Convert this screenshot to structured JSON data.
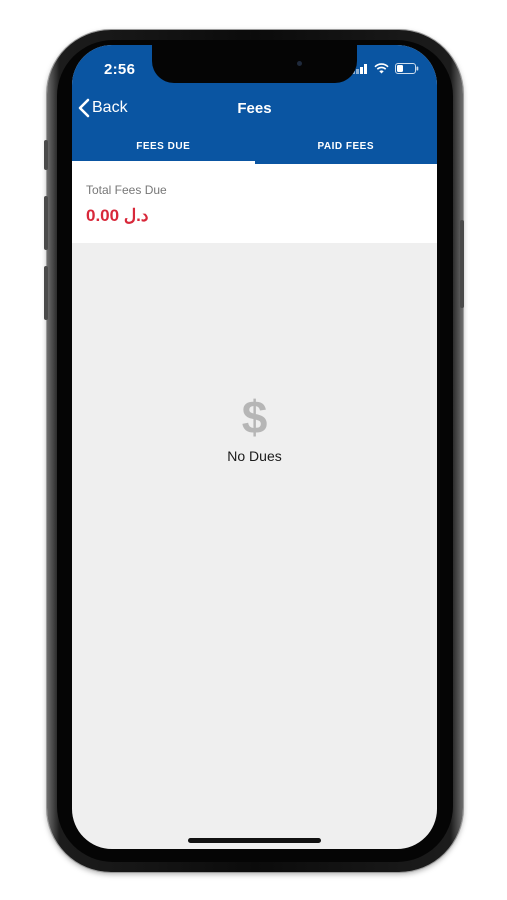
{
  "status_bar": {
    "time": "2:56",
    "icons": [
      "signal-icon",
      "wifi-icon",
      "battery-icon"
    ]
  },
  "nav": {
    "back_label": "Back",
    "title": "Fees"
  },
  "tabs": [
    {
      "label": "FEES DUE",
      "active": true
    },
    {
      "label": "PAID FEES",
      "active": false
    }
  ],
  "summary": {
    "label": "Total Fees Due",
    "amount": "0.00 د.ل"
  },
  "empty_state": {
    "icon": "dollar-icon",
    "glyph": "$",
    "text": "No Dues"
  },
  "colors": {
    "header": "#0a55a2",
    "amount": "#d8283a",
    "background": "#efefef"
  }
}
